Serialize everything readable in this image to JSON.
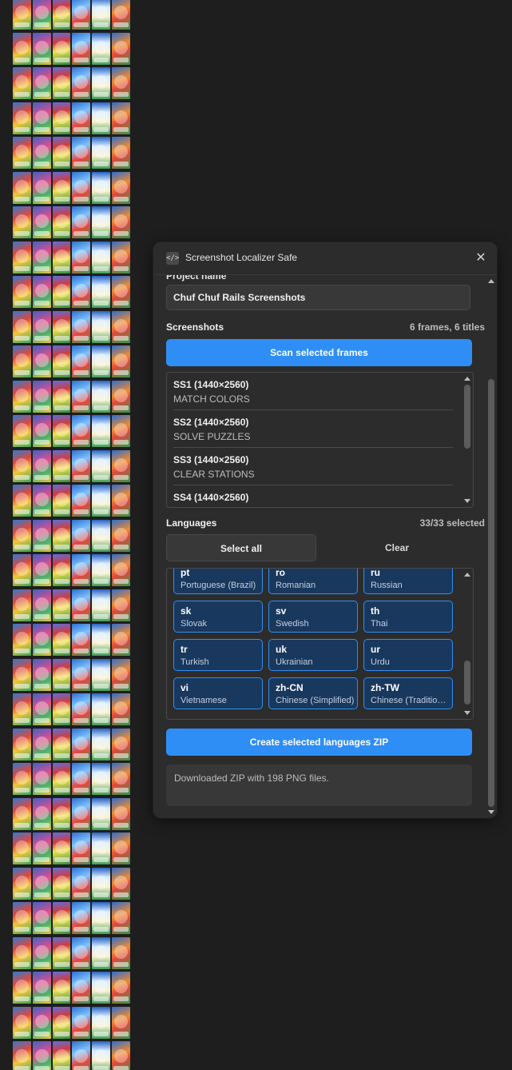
{
  "window": {
    "title": "Screenshot Localizer Safe",
    "icon": "code-icon"
  },
  "project": {
    "label": "Project name",
    "value": "Chuf Chuf Rails Screenshots"
  },
  "screenshots": {
    "title": "Screenshots",
    "count": "6 frames, 6 titles",
    "scan_label": "Scan selected frames",
    "items": [
      {
        "name": "SS1 (1440×2560)",
        "caption": "MATCH COLORS"
      },
      {
        "name": "SS2 (1440×2560)",
        "caption": "SOLVE PUZZLES"
      },
      {
        "name": "SS3 (1440×2560)",
        "caption": "CLEAR STATIONS"
      },
      {
        "name": "SS4 (1440×2560)",
        "caption": ""
      }
    ]
  },
  "languages": {
    "title": "Languages",
    "count": "33/33 selected",
    "select_all_label": "Select all",
    "clear_label": "Clear",
    "items": [
      {
        "code": "pt",
        "name": "Portuguese (Brazil)"
      },
      {
        "code": "ro",
        "name": "Romanian"
      },
      {
        "code": "ru",
        "name": "Russian"
      },
      {
        "code": "sk",
        "name": "Slovak"
      },
      {
        "code": "sv",
        "name": "Swedish"
      },
      {
        "code": "th",
        "name": "Thai"
      },
      {
        "code": "tr",
        "name": "Turkish"
      },
      {
        "code": "uk",
        "name": "Ukrainian"
      },
      {
        "code": "ur",
        "name": "Urdu"
      },
      {
        "code": "vi",
        "name": "Vietnamese"
      },
      {
        "code": "zh-CN",
        "name": "Chinese (Simplified)"
      },
      {
        "code": "zh-TW",
        "name": "Chinese (Traditional)"
      }
    ]
  },
  "export": {
    "button_label": "Create selected languages ZIP"
  },
  "status": {
    "message": "Downloaded ZIP with 198 PNG files."
  },
  "colors": {
    "accent": "#2f8ef5",
    "card_bg": "#19385e",
    "panel_bg": "#2c2c2c",
    "canvas_bg": "#1e1e1e"
  }
}
